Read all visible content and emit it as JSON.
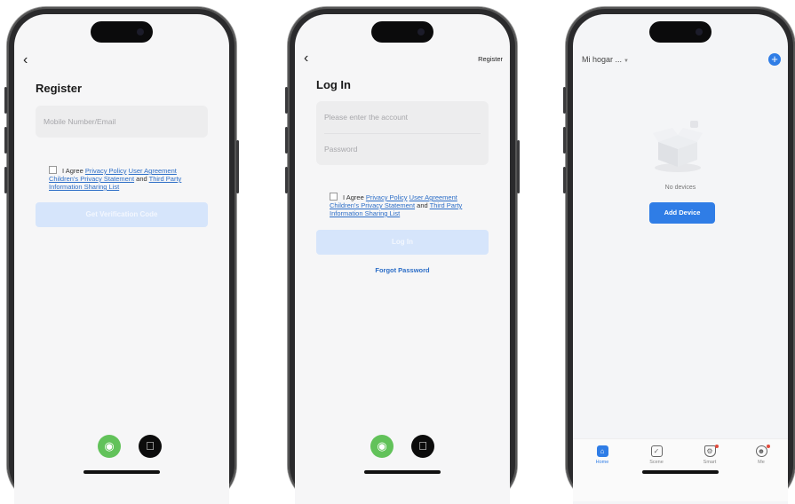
{
  "colors": {
    "accent": "#2f7de6",
    "link": "#2d6ec7",
    "wechat": "#62c25a",
    "disabled_button": "#d6e5fb"
  },
  "register_screen": {
    "back_icon": "chevron-left-icon",
    "title": "Register",
    "input_placeholder": "Mobile Number/Email",
    "agree": {
      "prefix": "I Agree",
      "privacy_policy": "Privacy Policy",
      "user_agreement": "User Agreement",
      "children_privacy": "Children's Privacy Statement",
      "and": "and",
      "third_party": "Third Party Information Sharing List"
    },
    "button_label": "Get Verification Code",
    "social_icons": [
      "wechat-icon",
      "apple-icon"
    ]
  },
  "login_screen": {
    "back_icon": "chevron-left-icon",
    "register_link": "Register",
    "title": "Log In",
    "account_placeholder": "Please enter the account",
    "password_placeholder": "Password",
    "agree": {
      "prefix": "I Agree",
      "privacy_policy": "Privacy Policy",
      "user_agreement": "User Agreement",
      "children_privacy": "Children's Privacy Statement",
      "and": "and",
      "third_party": "Third Party Information Sharing List"
    },
    "button_label": "Log In",
    "forgot_password": "Forgot Password",
    "social_icons": [
      "wechat-icon",
      "apple-icon"
    ]
  },
  "home_screen": {
    "home_name": "Mi hogar ...",
    "empty_text": "No devices",
    "add_device_label": "Add Device",
    "tabs": [
      {
        "label": "Home",
        "icon": "home-icon",
        "active": true
      },
      {
        "label": "Scene",
        "icon": "scene-icon",
        "active": false
      },
      {
        "label": "Smart",
        "icon": "smart-icon",
        "active": false
      },
      {
        "label": "Me",
        "icon": "profile-icon",
        "active": false
      }
    ]
  }
}
